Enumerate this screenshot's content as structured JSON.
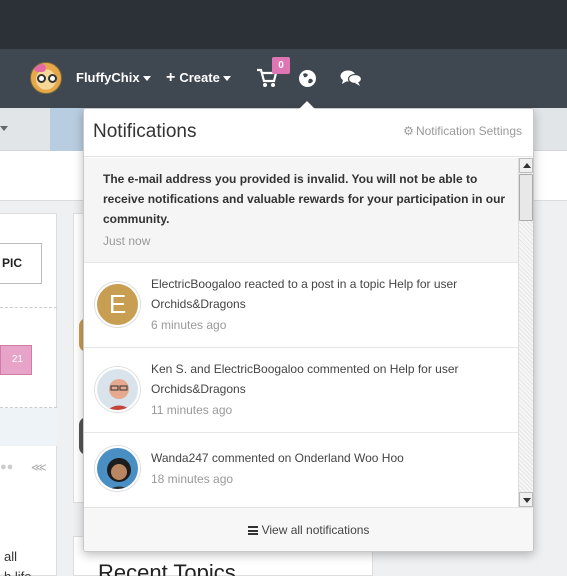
{
  "nav": {
    "username": "FluffyChix",
    "create_label": "Create",
    "cart_badge": "0",
    "icons": [
      "user-avatar",
      "plus-icon",
      "cart-icon",
      "globe-icon",
      "chat-icon"
    ]
  },
  "background": {
    "topic_button": "PIC",
    "pink_count": "21",
    "left_text": [
      "all",
      "h life"
    ],
    "recent_topics_title": "Recent Topics"
  },
  "notifications": {
    "title": "Notifications",
    "settings_label": "Notification Settings",
    "items": [
      {
        "text": "The e-mail address you provided is invalid. You will not be able to receive notifications and valuable rewards for your participation in our community.",
        "time": "Just now"
      },
      {
        "avatar_letter": "E",
        "text": "ElectricBoogaloo reacted to a post in a topic Help for user Orchids&Dragons",
        "time": "6 minutes ago"
      },
      {
        "text": "Ken S. and ElectricBoogaloo commented on Help for user Orchids&Dragons",
        "time": "11 minutes ago"
      },
      {
        "text": "Wanda247 commented on Onderland Woo Hoo",
        "time": "18 minutes ago"
      }
    ],
    "footer_label": "View all notifications"
  },
  "colors": {
    "nav_bg": "#3f4750",
    "top_bg": "#2c3138",
    "badge": "#e075b3",
    "avatar_e": "#c89e52"
  }
}
